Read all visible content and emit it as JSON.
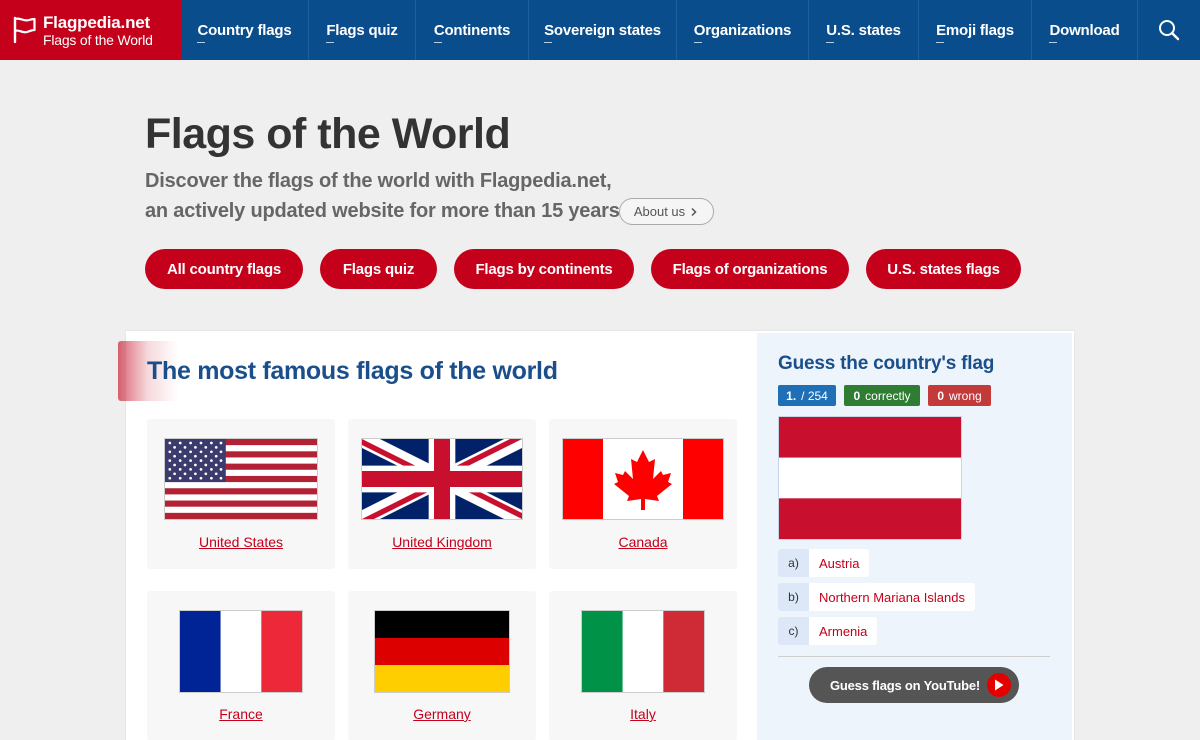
{
  "brand": {
    "name": "Flagpedia.net",
    "subtitle": "Flags of the World"
  },
  "nav": [
    "Country flags",
    "Flags quiz",
    "Continents",
    "Sovereign states",
    "Organizations",
    "U.S. states",
    "Emoji flags",
    "Download"
  ],
  "hero": {
    "title": "Flags of the World",
    "line1": "Discover the flags of the world with Flagpedia.net,",
    "line2": "an actively updated website for more than 15 years.",
    "about": "About us"
  },
  "cta": [
    "All country flags",
    "Flags quiz",
    "Flags by continents",
    "Flags of organizations",
    "U.S. states flags"
  ],
  "famous": {
    "title": "The most famous flags of the world",
    "flags": [
      "United States",
      "United Kingdom",
      "Canada",
      "France",
      "Germany",
      "Italy"
    ]
  },
  "quiz": {
    "title": "Guess the country's flag",
    "progress": {
      "current": "1.",
      "total": "/ 254"
    },
    "correct": {
      "count": "0",
      "label": "correctly"
    },
    "wrong": {
      "count": "0",
      "label": "wrong"
    },
    "answers": [
      {
        "key": "a)",
        "text": "Austria"
      },
      {
        "key": "b)",
        "text": "Northern Mariana Islands"
      },
      {
        "key": "c)",
        "text": "Armenia"
      }
    ],
    "youtube": "Guess flags on YouTube!"
  },
  "colors": {
    "brand_red": "#c4001a",
    "nav_blue": "#0a4d8c",
    "title_blue": "#1a4f8b",
    "badge_blue": "#1f6fb6",
    "badge_green": "#2e7d32",
    "badge_red": "#c33a3a"
  }
}
